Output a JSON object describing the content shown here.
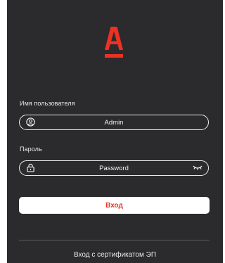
{
  "brand": {
    "logo_icon": "alfa-bank-logo",
    "accent_color": "#ef3124",
    "background_color": "#2b2b2d"
  },
  "login_form": {
    "username_label": "Имя пользователя",
    "username_value": "Admin",
    "username_icon": "user-circle-icon",
    "password_label": "Пароль",
    "password_placeholder": "Password",
    "password_icon": "lock-icon",
    "password_toggle_icon": "eye-closed-icon",
    "submit_label": "Вход"
  },
  "footer": {
    "certificate_login_label": "Вход с сертификатом ЭП"
  }
}
